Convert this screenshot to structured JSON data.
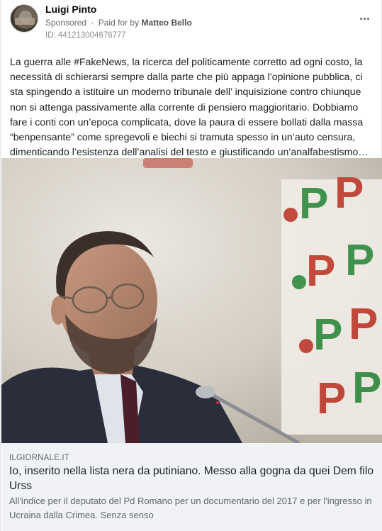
{
  "post": {
    "author": "Luigi Pinto",
    "sponsored_label": "Sponsored",
    "separator": "·",
    "paid_for_prefix": "Paid for by",
    "payer": "Matteo Bello",
    "ad_id": "ID: 441213004676777",
    "more_icon": "more-horizontal-icon",
    "text": "La guerra alle #FakeNews, la ricerca del politicamente corretto ad ogni costo, la necessità di schierarsi sempre dalla parte che più appaga l’opinione pubblica, ci sta spingendo a istituire un moderno tribunale dell’ inquisizione contro chiunque non si attenga passivamente alla corrente di pensiero maggioritario. Dobbiamo fare i conti con un’epoca complicata, dove la paura di essere bollati dalla massa “benpensante” come spregevoli e biechi si tramuta spesso in un’auto censura, dimenticando l’esistenza dell’analisi del testo e giustificando un’analfabestismo…"
  },
  "link": {
    "domain": "ILGIORNALE.IT",
    "headline": "Io, inserito nella lista nera da putiniano. Messo alla gogna da quei Dem filo Urss",
    "description": "All'indice per il deputato del Pd Romano per un documentario del 2017 e per l'ingresso in Ucraina dalla Crimea. Senza senso"
  },
  "photo_logo_text": "P"
}
